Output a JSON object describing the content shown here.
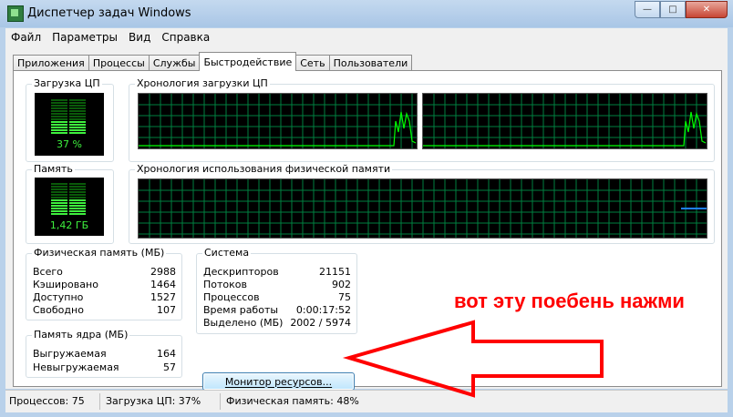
{
  "window": {
    "title": "Диспетчер задач Windows",
    "minimize": "—",
    "maximize": "□",
    "close": "✕"
  },
  "menu": [
    "Файл",
    "Параметры",
    "Вид",
    "Справка"
  ],
  "tabs": [
    "Приложения",
    "Процессы",
    "Службы",
    "Быстродействие",
    "Сеть",
    "Пользователи"
  ],
  "active_tab": "Быстродействие",
  "cpu": {
    "label": "Загрузка ЦП",
    "value": "37 %",
    "fraction": 0.37
  },
  "cpu_history": {
    "label": "Хронология загрузки ЦП"
  },
  "memory": {
    "label": "Память",
    "value": "1,42 ГБ",
    "fraction": 0.48
  },
  "memory_history": {
    "label": "Хронология использования физической памяти"
  },
  "physical_memory": {
    "label": "Физическая память (МБ)",
    "rows": [
      {
        "k": "Всего",
        "v": "2988"
      },
      {
        "k": "Кэшировано",
        "v": "1464"
      },
      {
        "k": "Доступно",
        "v": "1527"
      },
      {
        "k": "Свободно",
        "v": "107"
      }
    ]
  },
  "kernel_memory": {
    "label": "Память ядра (МБ)",
    "rows": [
      {
        "k": "Выгружаемая",
        "v": "164"
      },
      {
        "k": "Невыгружаемая",
        "v": "57"
      }
    ]
  },
  "system": {
    "label": "Система",
    "rows": [
      {
        "k": "Дескрипторов",
        "v": "21151"
      },
      {
        "k": "Потоков",
        "v": "902"
      },
      {
        "k": "Процессов",
        "v": "75"
      },
      {
        "k": "Время работы",
        "v": "0:00:17:52"
      },
      {
        "k": "Выделено (МБ)",
        "v": "2002 / 5974"
      }
    ]
  },
  "resource_monitor_button": "Монитор ресурсов...",
  "annotation": "вот эту поебень нажми",
  "statusbar": {
    "processes": "Процессов: 75",
    "cpu": "Загрузка ЦП: 37%",
    "memory": "Физическая память: 48%"
  },
  "colors": {
    "graph_grid": "#008040",
    "graph_line": "#00ff00",
    "memory_line": "#1e7fff",
    "annotation": "#ff0000"
  }
}
